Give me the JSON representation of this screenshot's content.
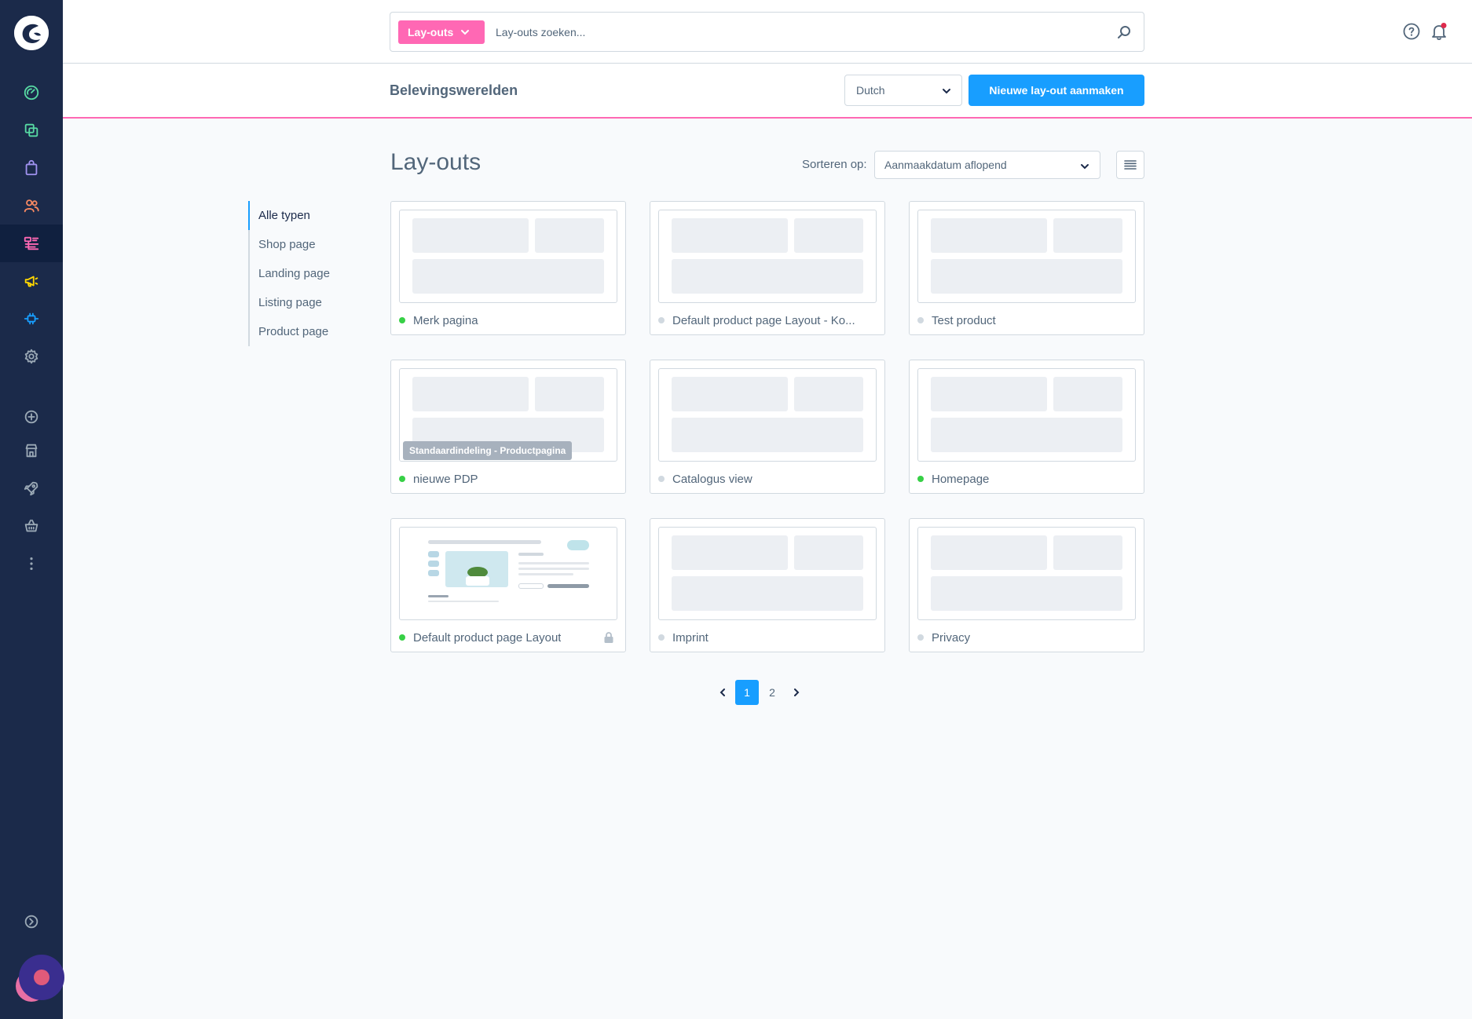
{
  "nav": {
    "icons": [
      {
        "name": "dashboard-icon",
        "color": "#57d9a3"
      },
      {
        "name": "catalogue-icon",
        "color": "#57d9a3"
      },
      {
        "name": "orders-icon",
        "color": "#a092f0"
      },
      {
        "name": "customers-icon",
        "color": "#f88962"
      },
      {
        "name": "content-icon",
        "color": "#ff68b4"
      },
      {
        "name": "marketing-icon",
        "color": "#ffd700"
      },
      {
        "name": "extensions-icon",
        "color": "#189eff"
      },
      {
        "name": "settings-icon",
        "color": "#9aa8b5"
      },
      {
        "name": "add-sales-channel-icon",
        "color": "#9aa8b5"
      },
      {
        "name": "storefront-icon",
        "color": "#9aa8b5"
      },
      {
        "name": "launch-icon",
        "color": "#9aa8b5"
      },
      {
        "name": "basket-icon",
        "color": "#9aa8b5"
      },
      {
        "name": "more-icon",
        "color": "#9aa8b5"
      },
      {
        "name": "collapse-menu-icon",
        "color": "#9aa8b5"
      }
    ]
  },
  "search": {
    "type_label": "Lay-outs",
    "placeholder": "Lay-outs zoeken..."
  },
  "smartbar": {
    "title": "Belevingswerelden",
    "language": "Dutch",
    "create_label": "Nieuwe lay-out aanmaken"
  },
  "content": {
    "heading": "Lay-outs",
    "sort_label": "Sorteren op:",
    "sort_value": "Aanmaakdatum aflopend"
  },
  "filters": [
    "Alle typen",
    "Shop page",
    "Landing page",
    "Listing page",
    "Product page"
  ],
  "cards": [
    {
      "name": "Merk pagina",
      "active": true
    },
    {
      "name": "Default product page Layout - Ko...",
      "active": false
    },
    {
      "name": "Test product",
      "active": false
    },
    {
      "name": "nieuwe PDP",
      "active": true,
      "badge": "Standaardindeling - Productpagina"
    },
    {
      "name": "Catalogus view",
      "active": false
    },
    {
      "name": "Homepage",
      "active": true
    },
    {
      "name": "Default product page Layout",
      "active": true,
      "locked": true,
      "preview": "product"
    },
    {
      "name": "Imprint",
      "active": false
    },
    {
      "name": "Privacy",
      "active": false
    }
  ],
  "pagination": {
    "pages": [
      "1",
      "2"
    ],
    "current": "1"
  },
  "colors": {
    "brand_pink": "#ff68b4",
    "primary_blue": "#189eff",
    "status_active": "#37d046",
    "status_inactive": "#d1d9e0",
    "nav_bg": "#1b2a4a"
  }
}
